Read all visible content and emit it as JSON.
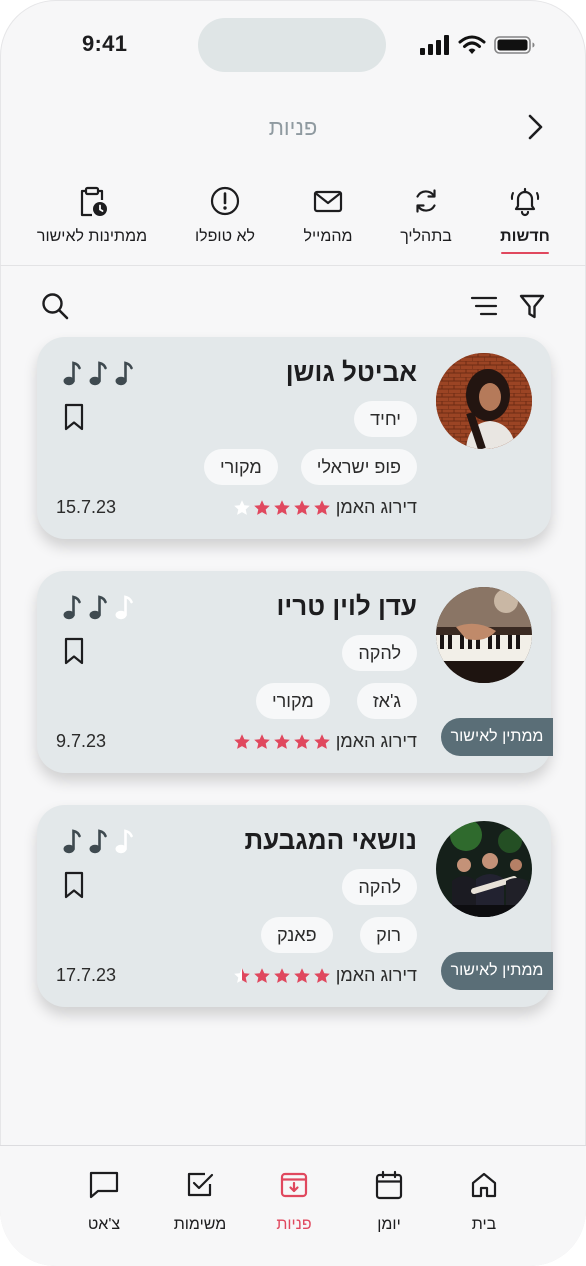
{
  "status_bar": {
    "time": "9:41"
  },
  "header": {
    "title": "פניות"
  },
  "tabs": [
    {
      "label": "חדשות",
      "icon": "bell-ring-icon",
      "active": true
    },
    {
      "label": "בתהליך",
      "icon": "refresh-icon",
      "active": false
    },
    {
      "label": "מהמייל",
      "icon": "mail-icon",
      "active": false
    },
    {
      "label": "לא טופלו",
      "icon": "alert-circle-icon",
      "active": false
    },
    {
      "label": "ממתינות לאישור",
      "icon": "clipboard-clock-icon",
      "active": false
    }
  ],
  "toolbar": {
    "filter_icon": "funnel-icon",
    "sort_icon": "sort-lines-icon",
    "search_icon": "search-icon"
  },
  "cards": [
    {
      "name": "אביטל גושן",
      "type_tag": "יחיד",
      "genre_tags": [
        "פופ ישראלי",
        "מקורי"
      ],
      "rating_label": "דירוג האמן",
      "rating": 4,
      "date": "15.7.23",
      "notes_level": 3,
      "status": ""
    },
    {
      "name": "עדן לוין טריו",
      "type_tag": "להקה",
      "genre_tags": [
        "ג'אז",
        "מקורי"
      ],
      "rating_label": "דירוג האמן",
      "rating": 5,
      "date": "9.7.23",
      "notes_level": 2,
      "status": "ממתין לאישור"
    },
    {
      "name": "נושאי המגבעת",
      "type_tag": "להקה",
      "genre_tags": [
        "רוק",
        "פאנק"
      ],
      "rating_label": "דירוג האמן",
      "rating": 4.5,
      "date": "17.7.23",
      "notes_level": 2,
      "status": "ממתין לאישור"
    }
  ],
  "bottom_nav": [
    {
      "label": "בית",
      "icon": "home-icon",
      "active": false
    },
    {
      "label": "יומן",
      "icon": "calendar-icon",
      "active": false
    },
    {
      "label": "פניות",
      "icon": "inbox-download-icon",
      "active": true
    },
    {
      "label": "משימות",
      "icon": "checkbox-icon",
      "active": false
    },
    {
      "label": "צ'אט",
      "icon": "chat-bubble-icon",
      "active": false
    }
  ],
  "colors": {
    "accent": "#e0485e",
    "card_bg": "#e3e8ea",
    "badge_bg": "#5a6e77",
    "icon": "#3f4a50"
  }
}
